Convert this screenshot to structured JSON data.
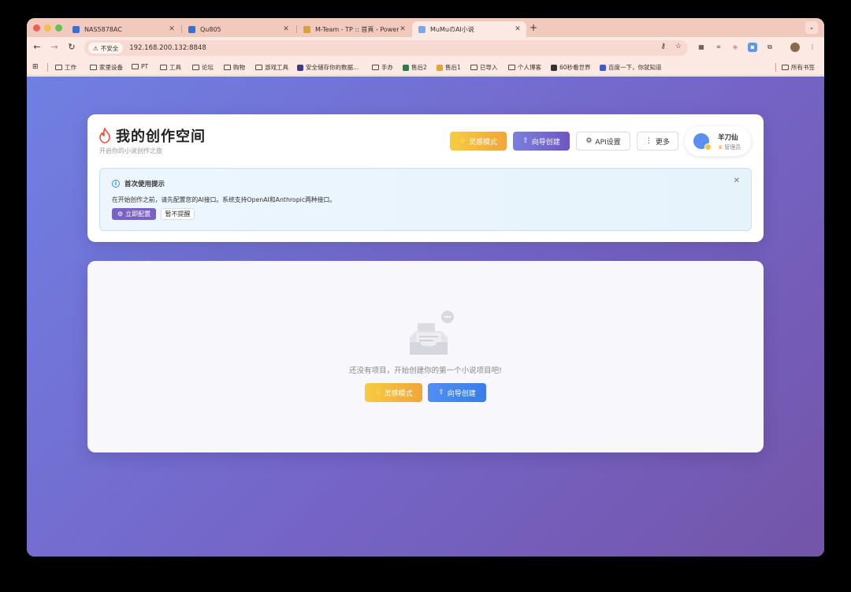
{
  "browser": {
    "tabs": [
      {
        "title": "NAS5878AC",
        "active": false
      },
      {
        "title": "Qu805",
        "active": false
      },
      {
        "title": "M-Team - TP :: 首頁 - Powere",
        "active": false
      },
      {
        "title": "MuMuのAI小说",
        "active": true
      }
    ],
    "new_tab_label": "+",
    "security_label": "不安全",
    "url": "192.168.200.132:8848",
    "bookmarks": [
      {
        "label": "工作",
        "type": "folder"
      },
      {
        "label": "家里设备",
        "type": "folder"
      },
      {
        "label": "PT",
        "type": "folder"
      },
      {
        "label": "工具",
        "type": "folder"
      },
      {
        "label": "论坛",
        "type": "folder"
      },
      {
        "label": "购物",
        "type": "folder"
      },
      {
        "label": "游戏工具",
        "type": "folder"
      },
      {
        "label": "安全储存你的数据...",
        "type": "site"
      },
      {
        "label": "手办",
        "type": "folder"
      },
      {
        "label": "售后2",
        "type": "site"
      },
      {
        "label": "售后1",
        "type": "site"
      },
      {
        "label": "已导入",
        "type": "folder"
      },
      {
        "label": "个人博客",
        "type": "folder"
      },
      {
        "label": "60秒看世界",
        "type": "site"
      },
      {
        "label": "百度一下，你就知道",
        "type": "site"
      }
    ],
    "all_bookmarks_label": "所有书签"
  },
  "header": {
    "title": "我的创作空间",
    "subtitle": "开启你的小说创作之旅",
    "buttons": {
      "inspire": "灵感模式",
      "wizard": "向导创建",
      "api": "API设置",
      "more": "更多"
    },
    "user": {
      "name": "羊刀仙",
      "role": "管理员"
    }
  },
  "notice": {
    "title": "首次使用提示",
    "text": "在开始创作之前，请先配置您的AI接口。系统支持OpenAI和Anthropic两种接口。",
    "configure_label": "立即配置",
    "later_label": "暂不提醒"
  },
  "empty_state": {
    "message": "还没有项目，开始创建你的第一个小说项目吧!",
    "inspire_label": "灵感模式",
    "wizard_label": "向导创建"
  },
  "colors": {
    "page_gradient_start": "#6f80e2",
    "page_gradient_end": "#7355a8",
    "inspire_button": "#f1a63a",
    "wizard_button": "#6e57c3",
    "empty_wizard_button": "#3a7ce8",
    "tab_strip": "#f2c9bd"
  }
}
